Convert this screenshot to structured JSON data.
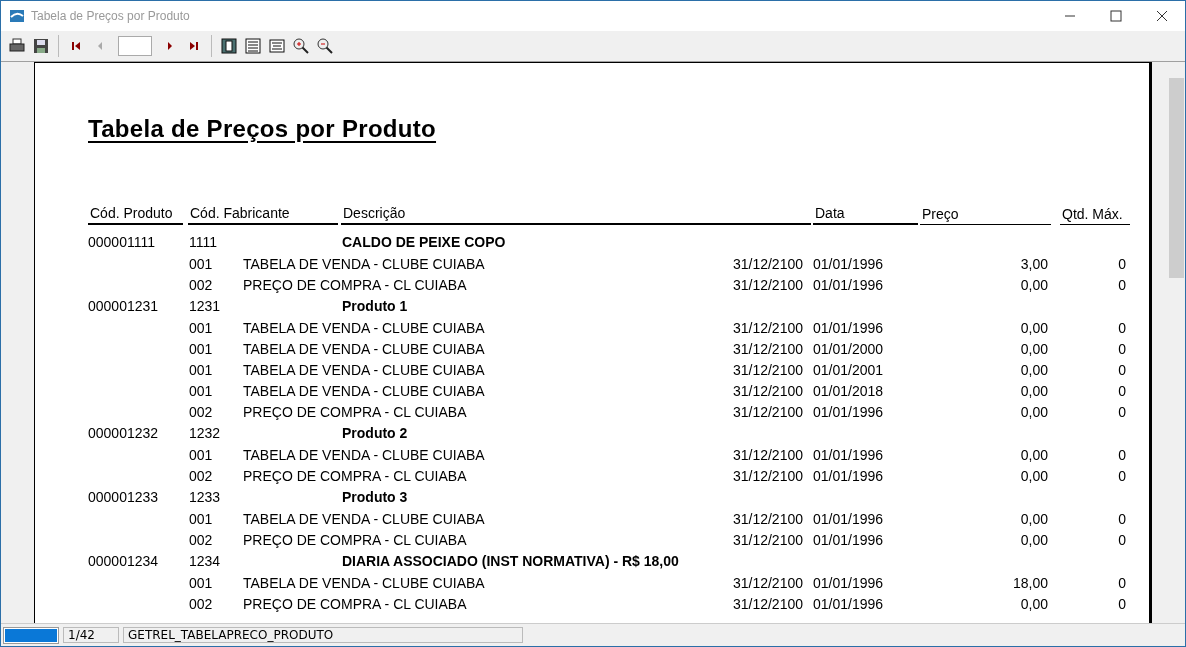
{
  "window": {
    "title": "Tabela de Preços por Produto"
  },
  "toolbar": {
    "prev_disabled": true
  },
  "report": {
    "title": "Tabela de Preços por Produto",
    "columns": [
      "Cód. Produto",
      "Cód. Fabricante",
      "Descrição",
      "Data",
      "Preço",
      "Qtd. Máx."
    ],
    "groups": [
      {
        "code": "000001111",
        "maker_code": "1111",
        "description": "CALDO DE PEIXE COPO",
        "items": [
          {
            "code": "001",
            "description": "TABELA DE VENDA - CLUBE CUIABA",
            "validity": "31/12/2100",
            "date": "01/01/1996",
            "price": "3,00",
            "qty": "0"
          },
          {
            "code": "002",
            "description": "PREÇO DE COMPRA - CL CUIABA",
            "validity": "31/12/2100",
            "date": "01/01/1996",
            "price": "0,00",
            "qty": "0"
          }
        ]
      },
      {
        "code": "000001231",
        "maker_code": "1231",
        "description": "Produto 1",
        "items": [
          {
            "code": "001",
            "description": "TABELA DE VENDA - CLUBE CUIABA",
            "validity": "31/12/2100",
            "date": "01/01/1996",
            "price": "0,00",
            "qty": "0"
          },
          {
            "code": "001",
            "description": "TABELA DE VENDA - CLUBE CUIABA",
            "validity": "31/12/2100",
            "date": "01/01/2000",
            "price": "0,00",
            "qty": "0"
          },
          {
            "code": "001",
            "description": "TABELA DE VENDA - CLUBE CUIABA",
            "validity": "31/12/2100",
            "date": "01/01/2001",
            "price": "0,00",
            "qty": "0"
          },
          {
            "code": "001",
            "description": "TABELA DE VENDA - CLUBE CUIABA",
            "validity": "31/12/2100",
            "date": "01/01/2018",
            "price": "0,00",
            "qty": "0"
          },
          {
            "code": "002",
            "description": "PREÇO DE COMPRA - CL CUIABA",
            "validity": "31/12/2100",
            "date": "01/01/1996",
            "price": "0,00",
            "qty": "0"
          }
        ]
      },
      {
        "code": "000001232",
        "maker_code": "1232",
        "description": "Produto 2",
        "items": [
          {
            "code": "001",
            "description": "TABELA DE VENDA - CLUBE CUIABA",
            "validity": "31/12/2100",
            "date": "01/01/1996",
            "price": "0,00",
            "qty": "0"
          },
          {
            "code": "002",
            "description": "PREÇO DE COMPRA - CL CUIABA",
            "validity": "31/12/2100",
            "date": "01/01/1996",
            "price": "0,00",
            "qty": "0"
          }
        ]
      },
      {
        "code": "000001233",
        "maker_code": "1233",
        "description": "Produto 3",
        "items": [
          {
            "code": "001",
            "description": "TABELA DE VENDA - CLUBE CUIABA",
            "validity": "31/12/2100",
            "date": "01/01/1996",
            "price": "0,00",
            "qty": "0"
          },
          {
            "code": "002",
            "description": "PREÇO DE COMPRA - CL CUIABA",
            "validity": "31/12/2100",
            "date": "01/01/1996",
            "price": "0,00",
            "qty": "0"
          }
        ]
      },
      {
        "code": "000001234",
        "maker_code": "1234",
        "description": "DIARIA ASSOCIADO (INST NORMATIVA) - R$ 18,00",
        "items": [
          {
            "code": "001",
            "description": "TABELA DE VENDA - CLUBE CUIABA",
            "validity": "31/12/2100",
            "date": "01/01/1996",
            "price": "18,00",
            "qty": "0"
          },
          {
            "code": "002",
            "description": "PREÇO DE COMPRA - CL CUIABA",
            "validity": "31/12/2100",
            "date": "01/01/1996",
            "price": "0,00",
            "qty": "0"
          }
        ]
      }
    ]
  },
  "status_bar": {
    "progress": {
      "level": 1
    },
    "page": "1/42",
    "report_name": "GETREL_TABELAPRECO_PRODUTO"
  }
}
